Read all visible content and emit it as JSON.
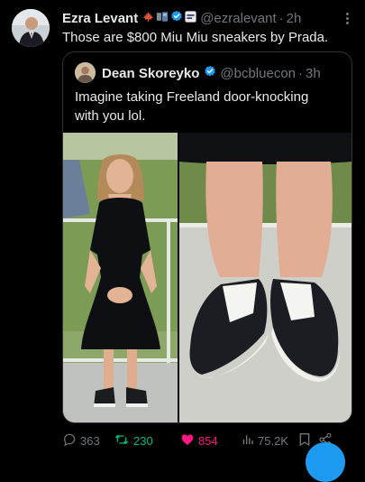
{
  "tweet": {
    "author_name": "Ezra Levant",
    "badge_icons": [
      "maple-leaf-icon",
      "blue-ribbon-icon",
      "verified-icon",
      "affiliate-badge-icon"
    ],
    "handle": "@ezralevant",
    "separator": "·",
    "time": "2h",
    "text": "Those are $800 Miu Miu sneakers by Prada."
  },
  "quoted": {
    "author_name": "Dean Skoreyko",
    "handle": "@bcbluecon",
    "separator": "·",
    "time": "3h",
    "text": "Imagine taking Freeland door-knocking with you lol.",
    "media": [
      "photo of a woman in a black dress standing on a porch",
      "close-up of black canvas sneakers with white laces"
    ]
  },
  "actions": {
    "replies": "363",
    "reposts": "230",
    "likes": "854",
    "views": "75.2K"
  },
  "colors": {
    "background": "#000000",
    "text": "#e7e9ea",
    "muted": "#71767b",
    "verified": "#1d9bf0",
    "repost": "#00ba7c",
    "like": "#f91880",
    "border": "#2f3336"
  }
}
